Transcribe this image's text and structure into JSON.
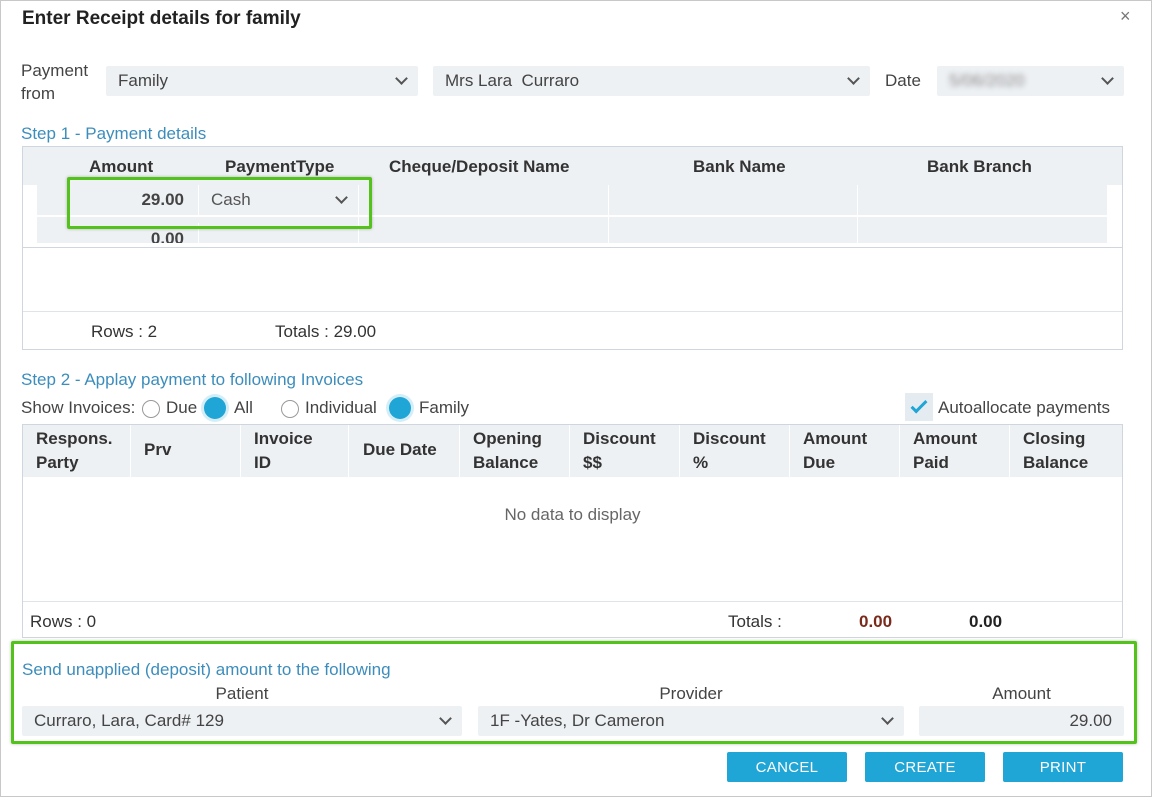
{
  "dialog": {
    "title": "Enter Receipt details for family",
    "close_glyph": "×"
  },
  "payment_from": {
    "label_line1": "Payment",
    "label_line2": "from",
    "type_value": "Family",
    "person_value": "Mrs Lara  Curraro",
    "date_label": "Date",
    "date_value": "5/06/2020"
  },
  "step1": {
    "title": "Step 1 - Payment details",
    "columns": [
      "Amount",
      "PaymentType",
      "Cheque/Deposit Name",
      "Bank Name",
      "Bank Branch"
    ],
    "rows": [
      {
        "amount": "29.00",
        "payment_type": "Cash"
      },
      {
        "amount": "0.00",
        "payment_type": ""
      }
    ],
    "rows_label": "Rows : 2",
    "totals_label": "Totals : 29.00"
  },
  "step2": {
    "title": "Step 2 - Applay payment to following Invoices",
    "show_label": "Show Invoices:",
    "radio_due": "Due",
    "radio_all": "All",
    "radio_individual": "Individual",
    "radio_family": "Family",
    "autoallocate": "Autoallocate payments",
    "columns": [
      {
        "line1": "Respons.",
        "line2": "Party"
      },
      {
        "line1": "Prv",
        "line2": ""
      },
      {
        "line1": "Invoice",
        "line2": "ID"
      },
      {
        "line1": "Due Date",
        "line2": ""
      },
      {
        "line1": "Opening",
        "line2": "Balance"
      },
      {
        "line1": "Discount",
        "line2": "$$"
      },
      {
        "line1": "Discount",
        "line2": "%"
      },
      {
        "line1": "Amount",
        "line2": "Due"
      },
      {
        "line1": "Amount",
        "line2": "Paid"
      },
      {
        "line1": "Closing",
        "line2": "Balance"
      }
    ],
    "empty_text": "No data to display",
    "rows_label": "Rows : 0",
    "totals_label": "Totals :",
    "total_due": "0.00",
    "total_paid": "0.00"
  },
  "deposit": {
    "title": "Send unapplied (deposit) amount to the following",
    "patient_label": "Patient",
    "patient_value": "Curraro, Lara, Card# 129",
    "provider_label": "Provider",
    "provider_value": "1F -Yates, Dr Cameron",
    "amount_label": "Amount",
    "amount_value": "29.00"
  },
  "buttons": {
    "cancel": "CANCEL",
    "create": "CREATE",
    "print": "PRINT"
  },
  "colors": {
    "accent": "#1fa5d6",
    "highlight": "#53c21a",
    "step_title": "#3c8dbc",
    "total_due": "#7a2a1a"
  }
}
